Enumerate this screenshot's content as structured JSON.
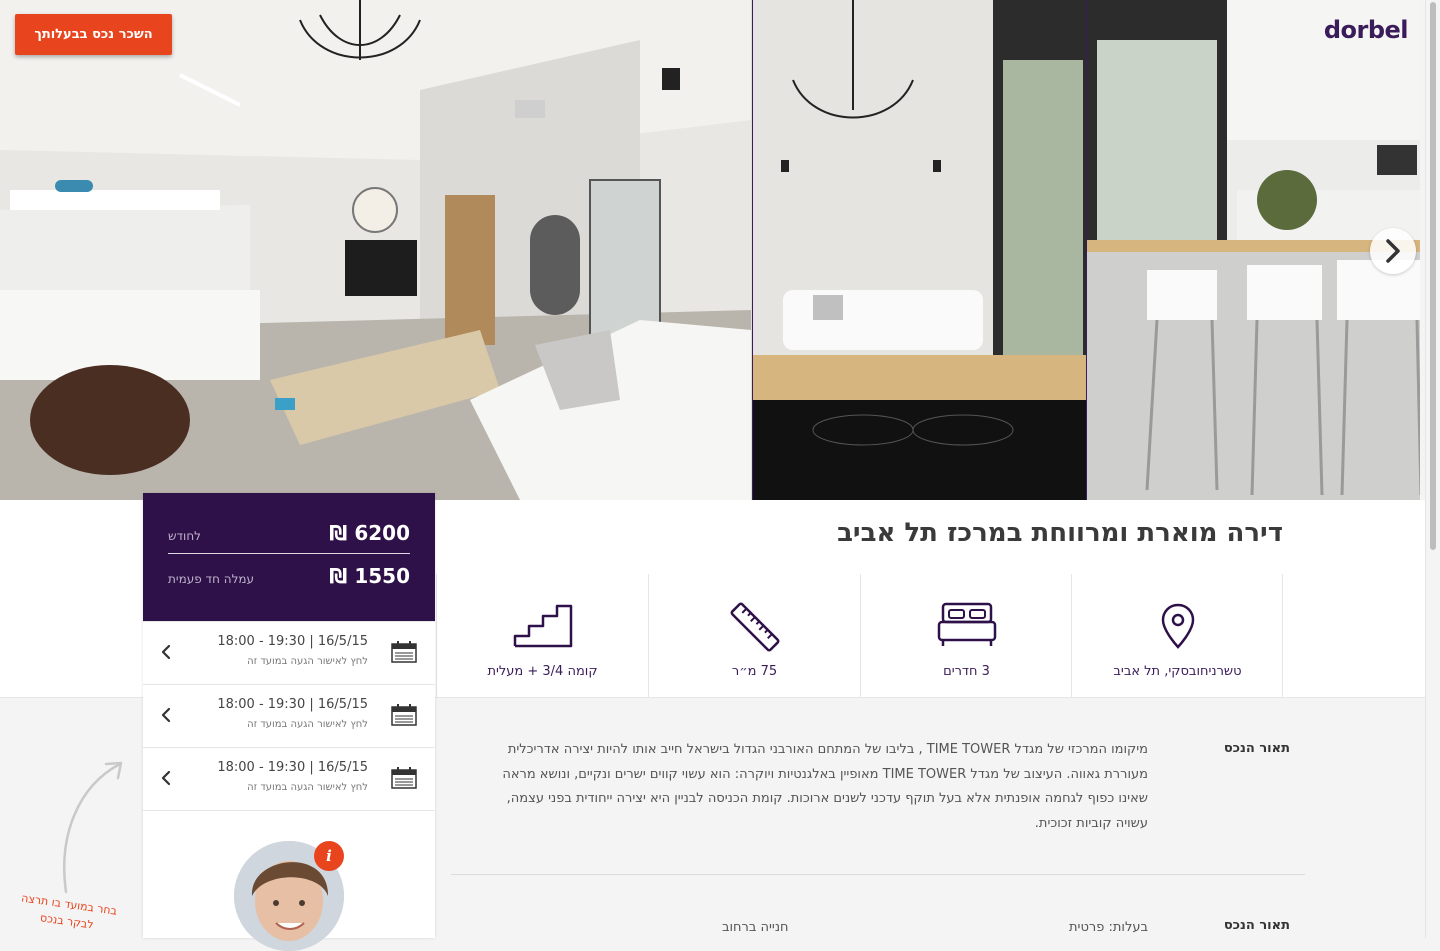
{
  "header": {
    "logo": "dorbel",
    "rent_button": "השכר נכס בבעלותך"
  },
  "gallery": {
    "next_icon": "chevron-right-icon"
  },
  "listing": {
    "title": "דירה מוארת ומרווחת במרכז תל אביב"
  },
  "features": [
    {
      "icon": "location-pin-icon",
      "label": "טשרניחובסקי, תל אביב"
    },
    {
      "icon": "bed-icon",
      "label": "3 חדרים"
    },
    {
      "icon": "ruler-icon",
      "label": "75 מ״ר"
    },
    {
      "icon": "stairs-icon",
      "label": "קומה 3/4 + מעלית"
    }
  ],
  "price": {
    "monthly_value": "6200 ₪",
    "monthly_label": "לחודש",
    "fee_value": "1550 ₪",
    "fee_label": "עמלה חד פעמית"
  },
  "slots": [
    {
      "time": "18:00 - 19:30  |  16/5/15",
      "sub": "לחץ לאישור הגעה במועד זה"
    },
    {
      "time": "18:00 - 19:30  |  16/5/15",
      "sub": "לחץ לאישור הגעה במועד זה"
    },
    {
      "time": "18:00 - 19:30  |  16/5/15",
      "sub": "לחץ לאישור הגעה במועד זה"
    }
  ],
  "agent": {
    "info_badge": "i"
  },
  "hint": "בחר במועד בו תרצה לבקר בנכס",
  "description": {
    "heading": "תאור הנכס",
    "text": "מיקומו המרכזי של מגדל TIME TOWER , בליבו של המתחם האורבני הגדול בישראל חייב אותו להיות יצירה אדריכלית מעוררת גאווה. העיצוב של מגדל TIME TOWER מאופיין באלגנטיות ויוקרה: הוא עשוי קווים ישרים ונקיים, ונושא מראה שאינו כפוף לגחמה אופנתית אלא בעל תוקף עדכני לשנים ארוכות. קומת הכניסה לבניין היא יצירה ייחודית בפני עצמה, עשויה קוביות זכוכית.",
    "heading2": "תאור הנכס",
    "ownership": "בעלות: פרטית",
    "parking": "חנייה ברחוב"
  },
  "colors": {
    "brand_purple": "#2e1148",
    "accent_orange": "#e8451e"
  }
}
